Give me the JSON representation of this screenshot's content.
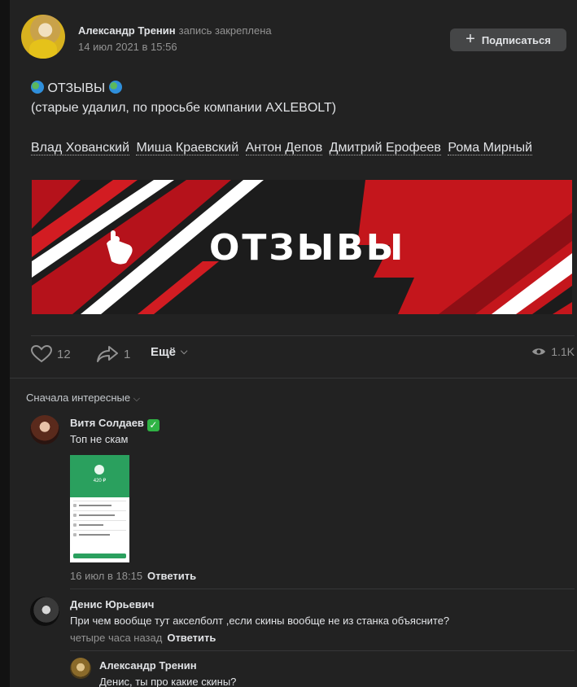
{
  "post": {
    "author": "Александр Тренин",
    "pinned_note": "запись закреплена",
    "date": "14 июл 2021 в 15:56",
    "subscribe_label": "Подписаться",
    "title": "ОТЗЫВЫ",
    "subtitle": "(старые удалил, по просьбе компании AXLEBOLT)",
    "mentions": [
      "Влад Хованский",
      "Миша Краевский",
      "Антон Депов",
      "Дмитрий Ерофеев",
      "Рома Мирный"
    ],
    "banner_text": "ОТЗЫВЫ",
    "likes": "12",
    "shares": "1",
    "more_label": "Ещё",
    "views": "1.1K"
  },
  "comments": {
    "sort_label": "Сначала интересные",
    "items": [
      {
        "name": "Витя Солдаев",
        "text": "Топ не скам",
        "date": "16 июл в 18:15",
        "reply_label": "Ответить",
        "attachment": {
          "amount": "420 ₽"
        }
      },
      {
        "name": "Денис Юрьевич",
        "text": "При чем вообще тут акселболт ,если скины вообще не из станка объясните?",
        "date": "четыре часа назад",
        "reply_label": "Ответить"
      },
      {
        "name": "Александр Тренин",
        "text": "Денис, ты про какие скины?"
      }
    ]
  },
  "colors": {
    "background": "#222222",
    "banner_red": "#c4161c",
    "check_green": "#2fb344"
  }
}
